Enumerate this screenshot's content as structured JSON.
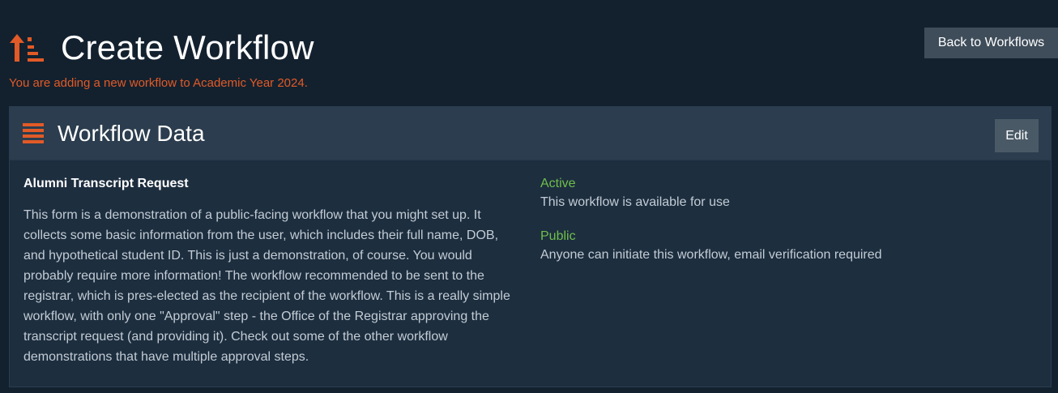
{
  "header": {
    "icon": "sort-up-list-icon",
    "title": "Create Workflow",
    "subtitle": "You are adding a new workflow to Academic Year 2024.",
    "back_button_label": "Back to Workflows"
  },
  "panel": {
    "icon": "list-bars-icon",
    "title": "Workflow Data",
    "edit_button_label": "Edit",
    "workflow_name": "Alumni Transcript Request",
    "workflow_description": "This form is a demonstration of a public-facing workflow that you might set up. It collects some basic information from the user, which includes their full name, DOB, and hypothetical student ID. This is just a demonstration, of course. You would probably require more information! The workflow recommended to be sent to the registrar, which is pres-elected as the recipient of the workflow. This is a really simple workflow, with only one \"Approval\" step - the Office of the Registrar approving the transcript request (and providing it). Check out some of the other workflow demonstrations that have multiple approval steps.",
    "statuses": [
      {
        "label": "Active",
        "text": "This workflow is available for use"
      },
      {
        "label": "Public",
        "text": "Anyone can initiate this workflow, email verification required"
      }
    ]
  },
  "colors": {
    "background": "#13212f",
    "accent": "#e25a26",
    "status_green": "#6fbf4a",
    "panel_header": "#2b3d4e",
    "panel_body": "#1d2e3f"
  }
}
